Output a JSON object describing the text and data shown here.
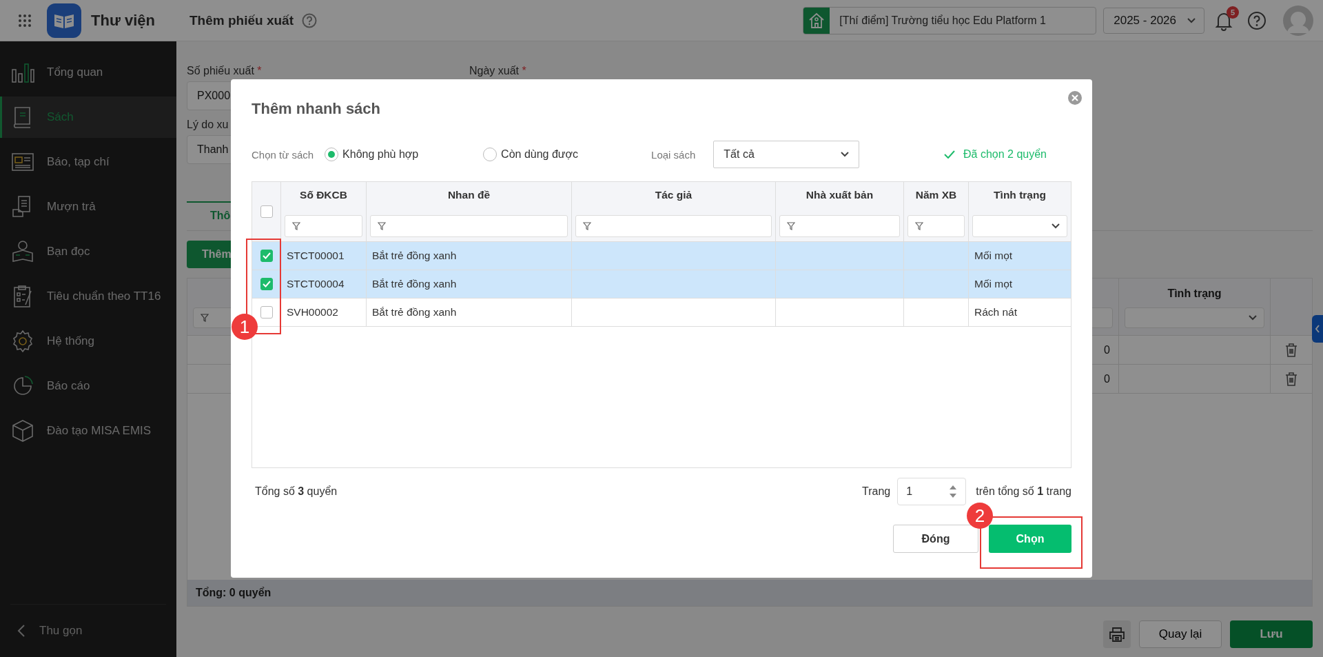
{
  "app": {
    "name": "Thư viện"
  },
  "page_title": "Thêm phiếu xuất",
  "header": {
    "school": "[Thí điểm] Trường tiểu học Edu Platform 1",
    "school_year": "2025 - 2026",
    "notification_count": "5"
  },
  "sidebar": {
    "items": [
      {
        "label": "Tổng quan",
        "selected": false
      },
      {
        "label": "Sách",
        "selected": true
      },
      {
        "label": "Báo, tạp chí",
        "selected": false
      },
      {
        "label": "Mượn trả",
        "selected": false
      },
      {
        "label": "Bạn đọc",
        "selected": false
      },
      {
        "label": "Tiêu chuẩn theo TT16",
        "selected": false
      },
      {
        "label": "Hệ thống",
        "selected": false
      },
      {
        "label": "Báo cáo",
        "selected": false
      },
      {
        "label": "Đào tạo MISA EMIS",
        "selected": false
      }
    ],
    "collapse_label": "Thu gọn"
  },
  "form": {
    "fields": [
      {
        "label": "Số phiếu xuất",
        "required_mark": "*",
        "value": "PX000"
      },
      {
        "label": "Ngày xuất",
        "required_mark": "*"
      },
      {
        "label": "Lý do xu",
        "value": "Thanh"
      }
    ],
    "tab": "Thô",
    "add_button": "Thêm",
    "table": {
      "columns": [
        "Tình trạng"
      ],
      "rows": [
        {
          "quantity": "0"
        },
        {
          "quantity": "0"
        }
      ]
    },
    "total": "Tổng: 0 quyển"
  },
  "actions": {
    "back": "Quay lại",
    "save": "Lưu"
  },
  "dialog": {
    "title": "Thêm nhanh sách",
    "source_label": "Chọn từ sách",
    "source_options": [
      {
        "label": "Không phù hợp",
        "selected": true
      },
      {
        "label": "Còn dùng được",
        "selected": false
      }
    ],
    "type_label": "Loại sách",
    "type_value": "Tất cả",
    "selected_count": "Đã chọn 2 quyển",
    "table": {
      "columns": [
        "Số ĐKCB",
        "Nhan đề",
        "Tác giả",
        "Nhà xuất bản",
        "Năm XB",
        "Tình trạng"
      ],
      "all_checked": false,
      "rows": [
        {
          "checked": true,
          "code": "STCT00001",
          "title": "Bắt trẻ đồng xanh",
          "condition": "Mối mọt"
        },
        {
          "checked": true,
          "code": "STCT00004",
          "title": "Bắt trẻ đồng xanh",
          "condition": "Mối mọt"
        },
        {
          "checked": false,
          "code": "SVH00002",
          "title": "Bắt trẻ đồng xanh",
          "condition": "Rách nát"
        }
      ]
    },
    "total": "Tổng số **3** quyển",
    "page_label": "Trang",
    "page_value": "1",
    "page_total": "trên tổng số **1** trang",
    "close_button": "Đóng",
    "choose_button": "Chọn"
  },
  "callouts": [
    {
      "label": "1"
    },
    {
      "label": "2"
    }
  ]
}
